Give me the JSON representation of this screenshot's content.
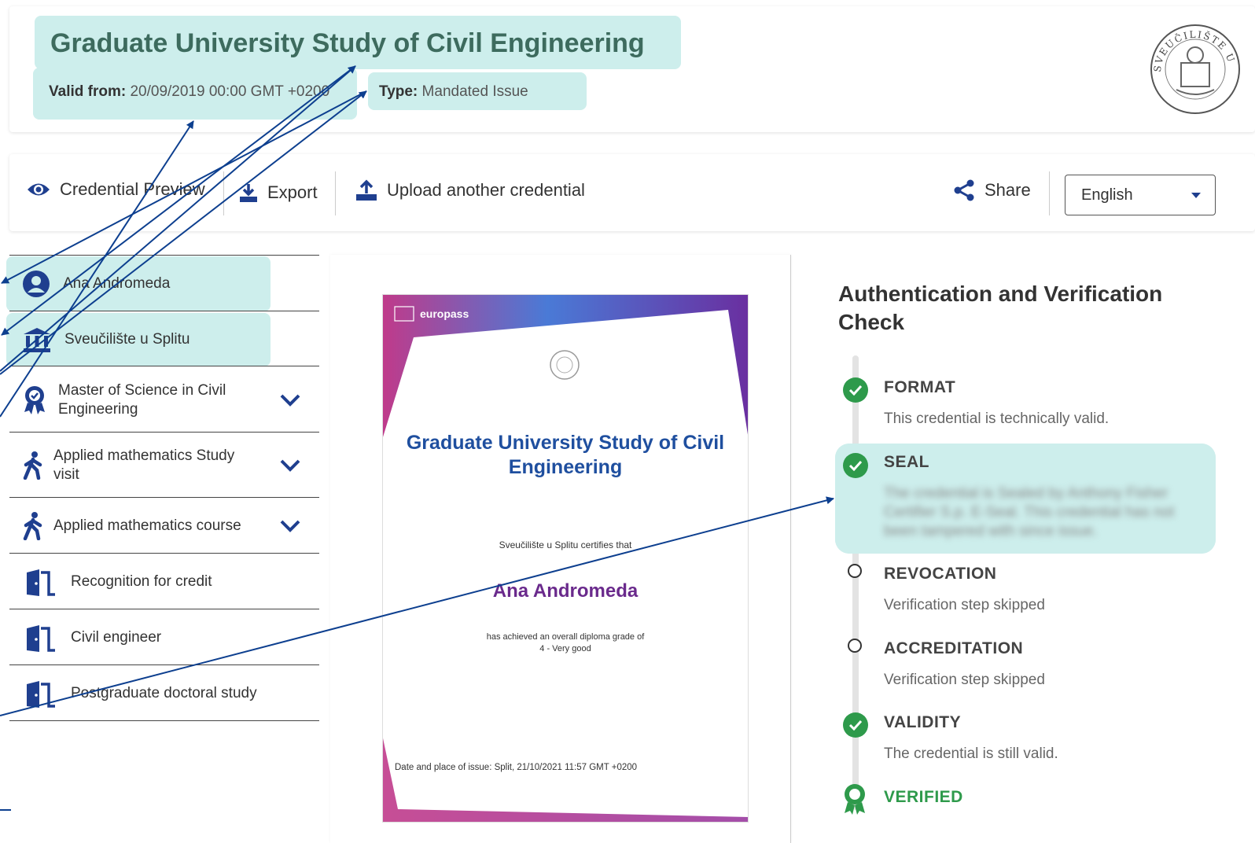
{
  "header": {
    "title": "Graduate University Study of Civil Engineering",
    "valid_from_label": "Valid from:",
    "valid_from_value": "20/09/2019 00:00 GMT +0200",
    "type_label": "Type:",
    "type_value": "Mandated Issue",
    "seal_text": "SVEUČILIŠTE U SPLITU"
  },
  "toolbar": {
    "preview_label": "Credential Preview",
    "export_label": "Export",
    "upload_label": "Upload another credential",
    "share_label": "Share",
    "language_value": "English"
  },
  "sidebar": {
    "items": [
      {
        "label": "Ana Andromeda",
        "icon": "user-icon"
      },
      {
        "label": "Sveučilište u Splitu",
        "icon": "institution-icon"
      },
      {
        "label": "Master of Science in Civil Engineering",
        "icon": "award-icon"
      },
      {
        "label": "Applied mathematics Study visit",
        "icon": "walking-icon"
      },
      {
        "label": "Applied mathematics course",
        "icon": "walking-icon"
      },
      {
        "label": "Recognition for credit",
        "icon": "door-icon"
      },
      {
        "label": "Civil engineer",
        "icon": "door-icon"
      },
      {
        "label": "Postgraduate doctoral study",
        "icon": "door-icon"
      }
    ]
  },
  "certificate": {
    "brand": "europass",
    "title": "Graduate University Study of Civil Engineering",
    "certifies_text": "Sveučilište u Splitu certifies that",
    "holder_name": "Ana Andromeda",
    "achieved_text": "has achieved an overall diploma grade of",
    "grade_text": "4 - Very good",
    "issue_text": "Date and place of issue: Split, 21/10/2021 11:57 GMT +0200"
  },
  "verification": {
    "title": "Authentication and Verification Check",
    "steps": [
      {
        "name": "FORMAT",
        "status": "ok",
        "desc": "This credential is technically valid."
      },
      {
        "name": "SEAL",
        "status": "ok",
        "desc": "The credential is Sealed by Anthony Fisher Certifier S.p. E-Seal. This credential has not been tampered with since issue."
      },
      {
        "name": "REVOCATION",
        "status": "skipped",
        "desc": "Verification step skipped"
      },
      {
        "name": "ACCREDITATION",
        "status": "skipped",
        "desc": "Verification step skipped"
      },
      {
        "name": "VALIDITY",
        "status": "ok",
        "desc": "The credential is still valid."
      }
    ],
    "result": "VERIFIED"
  },
  "colors": {
    "highlight": "#cdeeec",
    "primary_blue": "#1f3f8f",
    "ok_green": "#2e9a4b",
    "title_green": "#3d6b5e",
    "holder_purple": "#6a2a8c",
    "annotation_arrow": "#0d3f8f"
  }
}
